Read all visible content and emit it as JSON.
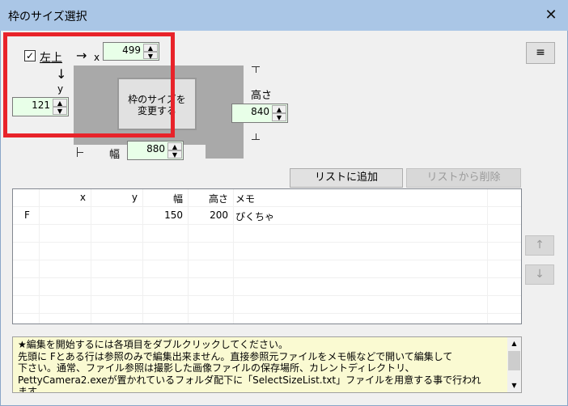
{
  "window": {
    "title": "枠のサイズ選択",
    "close_glyph": "✕"
  },
  "topleft": {
    "checkbox_checked": true,
    "label": "左上",
    "arrow_right": "→",
    "x_label": "x",
    "arrow_down": "↓",
    "y_label": "y",
    "x_value": "499",
    "y_value": "121"
  },
  "size": {
    "height_label": "高さ",
    "height_value": "840",
    "width_label": "幅",
    "width_value": "880",
    "change_button": "枠のサイズを\n変更する"
  },
  "menu_button": "≡",
  "actions": {
    "add": "リストに追加",
    "remove": "リストから削除"
  },
  "list": {
    "columns": [
      "",
      "x",
      "y",
      "幅",
      "高さ",
      "メモ"
    ],
    "rows": [
      {
        "c0": "F",
        "x": "",
        "y": "",
        "w": "150",
        "h": "200",
        "memo": "ぴくちゃ"
      }
    ]
  },
  "side_buttons": {
    "up": "↑",
    "down": "↓"
  },
  "info": {
    "lines": [
      "★編集を開始するには各項目をダブルクリックしてください。",
      "先頭に Fとある行は参照のみで編集出来ません。直接参照元ファイルをメモ帳などで開いて編集して",
      "下さい。通常、ファイル参照は撮影した画像ファイルの保存場所、カレントディレクトリ、",
      "PettyCamera2.exeが置かれているフォルダ配下に「SelectSizeList.txt」ファイルを用意する事で行われ",
      "ます。"
    ]
  },
  "colors": {
    "titlebar": "#aac6e6",
    "highlight": "#e8232a",
    "spin_bg": "#e8ffe8",
    "info_bg": "#fafad2"
  }
}
